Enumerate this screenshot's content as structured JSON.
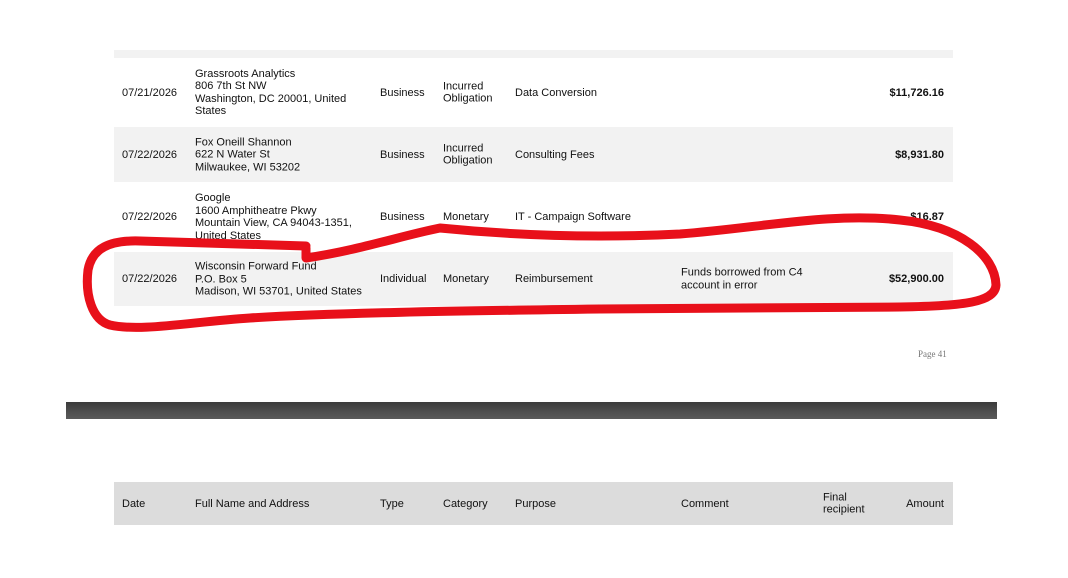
{
  "rows": [
    {
      "date": "07/21/2026",
      "name_lines": [
        "Grassroots Analytics",
        "806 7th St NW",
        "Washington, DC 20001, United",
        "States"
      ],
      "type": "Business",
      "category_lines": [
        "Incurred",
        "Obligation"
      ],
      "purpose": "Data Conversion",
      "comment_lines": [],
      "amount": "$11,726.16"
    },
    {
      "date": "07/22/2026",
      "name_lines": [
        "Fox Oneill Shannon",
        "622 N Water St",
        "Milwaukee, WI 53202"
      ],
      "type": "Business",
      "category_lines": [
        "Incurred",
        "Obligation"
      ],
      "purpose": "Consulting Fees",
      "comment_lines": [],
      "amount": "$8,931.80"
    },
    {
      "date": "07/22/2026",
      "name_lines": [
        "Google",
        "1600 Amphitheatre Pkwy",
        "Mountain View, CA 94043-1351,",
        "United States"
      ],
      "type": "Business",
      "category_lines": [
        "Monetary"
      ],
      "purpose": "IT - Campaign Software",
      "comment_lines": [],
      "amount": "$16.87"
    },
    {
      "date": "07/22/2026",
      "name_lines": [
        "Wisconsin Forward Fund",
        "P.O. Box 5",
        "Madison, WI 53701, United States"
      ],
      "type": "Individual",
      "category_lines": [
        "Monetary"
      ],
      "purpose": "Reimbursement",
      "comment_lines": [
        "Funds borrowed from C4",
        "account in error"
      ],
      "amount": "$52,900.00"
    }
  ],
  "page_number": "Page 41",
  "header": {
    "date": "Date",
    "full_name": "Full Name and Address",
    "type": "Type",
    "category": "Category",
    "purpose": "Purpose",
    "comment": "Comment",
    "final_recipient_lines": [
      "Final",
      "recipient"
    ],
    "amount": "Amount"
  },
  "annotation": {
    "color": "#e8101a",
    "description_icon": "red-hand-drawn-circle-icon"
  }
}
